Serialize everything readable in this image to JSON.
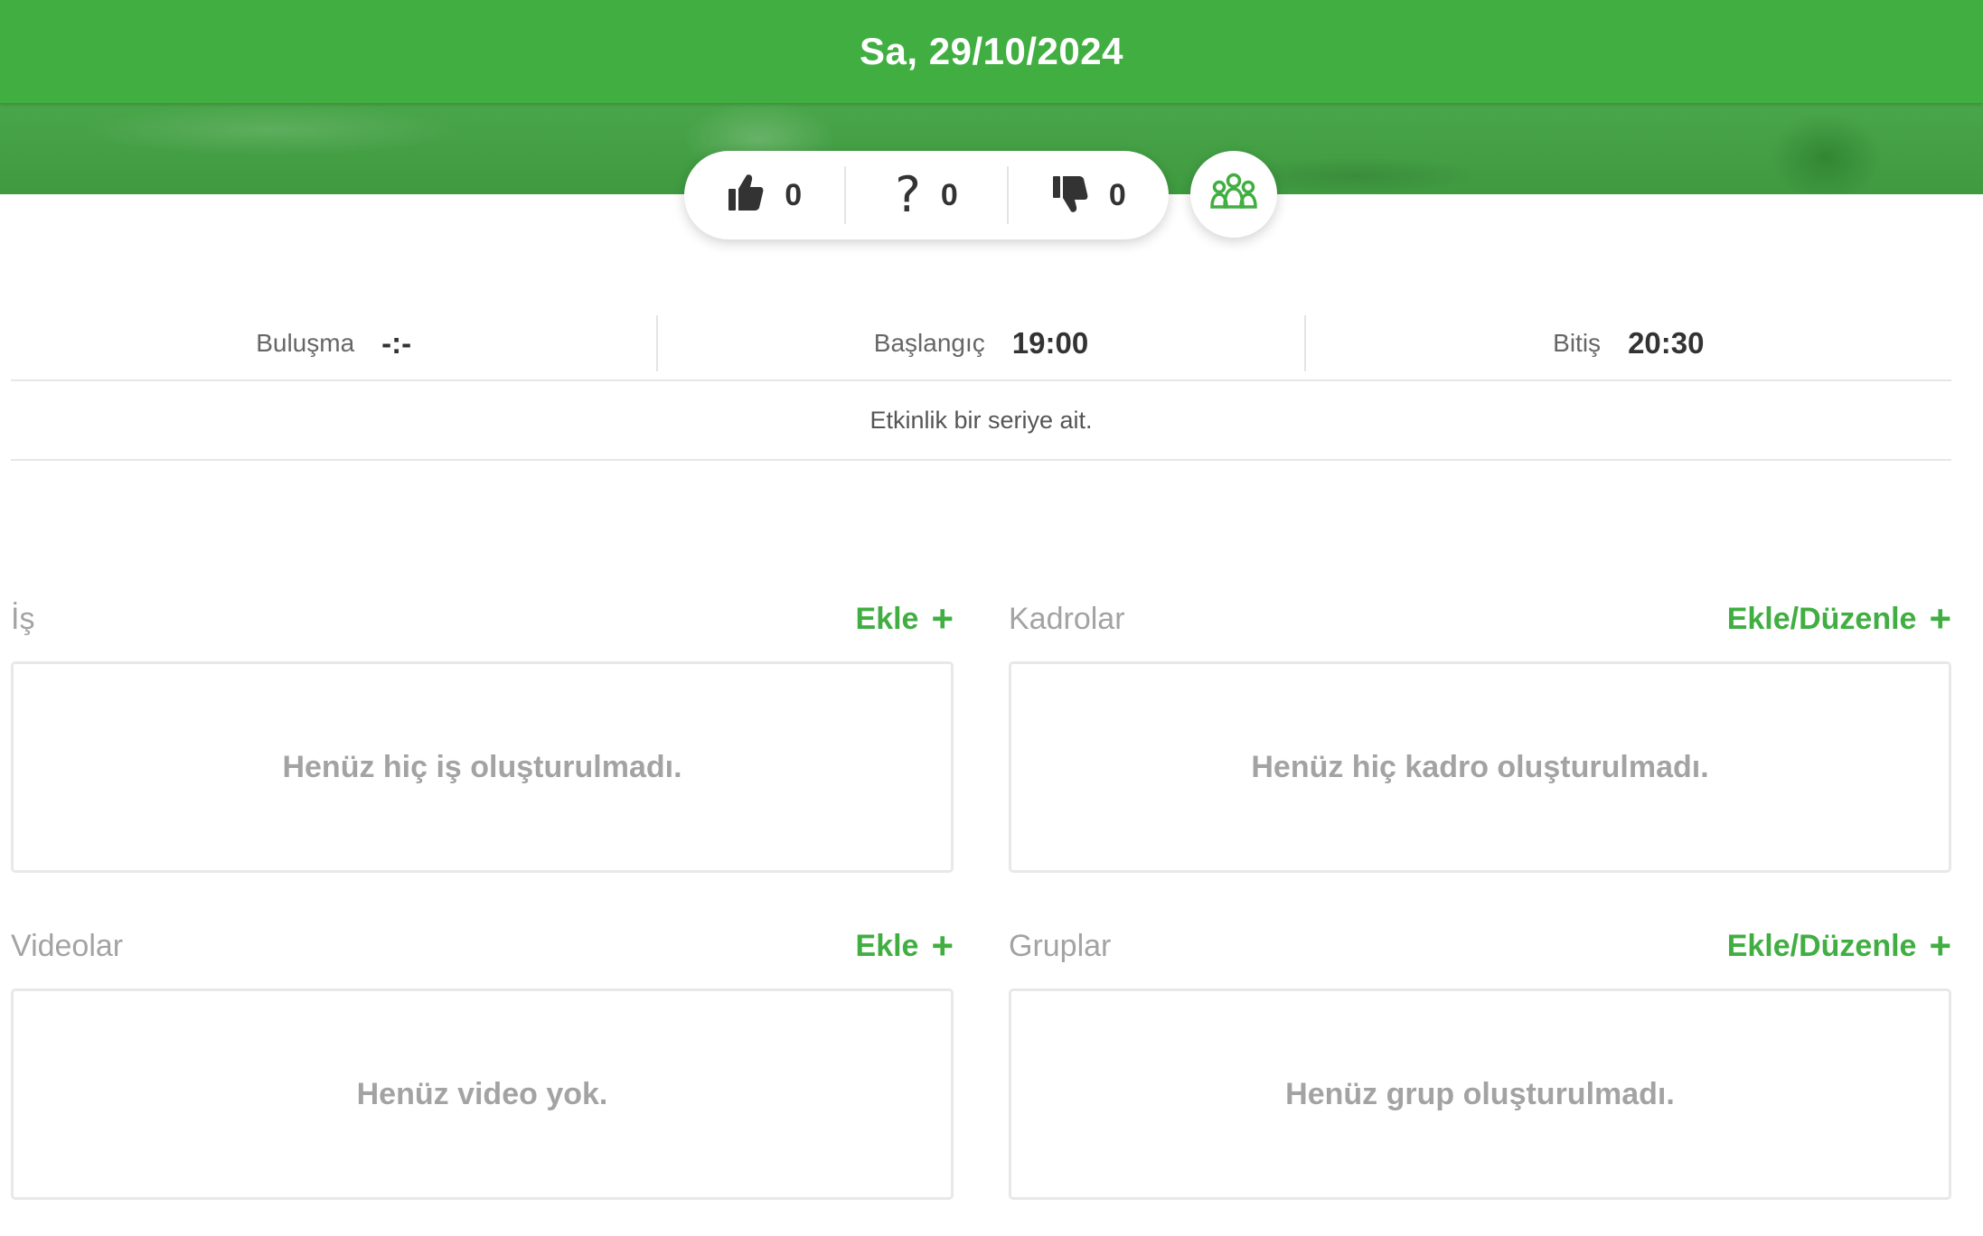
{
  "header": {
    "date": "Sa, 29/10/2024"
  },
  "rsvp": {
    "yes_count": "0",
    "maybe_symbol": "?",
    "maybe_count": "0",
    "no_count": "0"
  },
  "times": {
    "meet_label": "Buluşma",
    "meet_value": "-:-",
    "start_label": "Başlangıç",
    "start_value": "19:00",
    "end_label": "Bitiş",
    "end_value": "20:30"
  },
  "series_note": "Etkinlik bir seriye ait.",
  "sections": {
    "tasks": {
      "title": "İş",
      "action": "Ekle",
      "empty": "Henüz hiç iş oluşturulmadı."
    },
    "lineups": {
      "title": "Kadrolar",
      "action": "Ekle/Düzenle",
      "empty": "Henüz hiç kadro oluşturulmadı."
    },
    "videos": {
      "title": "Videolar",
      "action": "Ekle",
      "empty": "Henüz video yok."
    },
    "groups": {
      "title": "Gruplar",
      "action": "Ekle/Düzenle",
      "empty": "Henüz grup oluşturulmadı."
    }
  },
  "colors": {
    "brand_green": "#41ae42",
    "muted_text": "#a3a3a3"
  },
  "icons": [
    "thumbs-up-icon",
    "question-icon",
    "thumbs-down-icon",
    "group-icon",
    "plus-icon"
  ]
}
